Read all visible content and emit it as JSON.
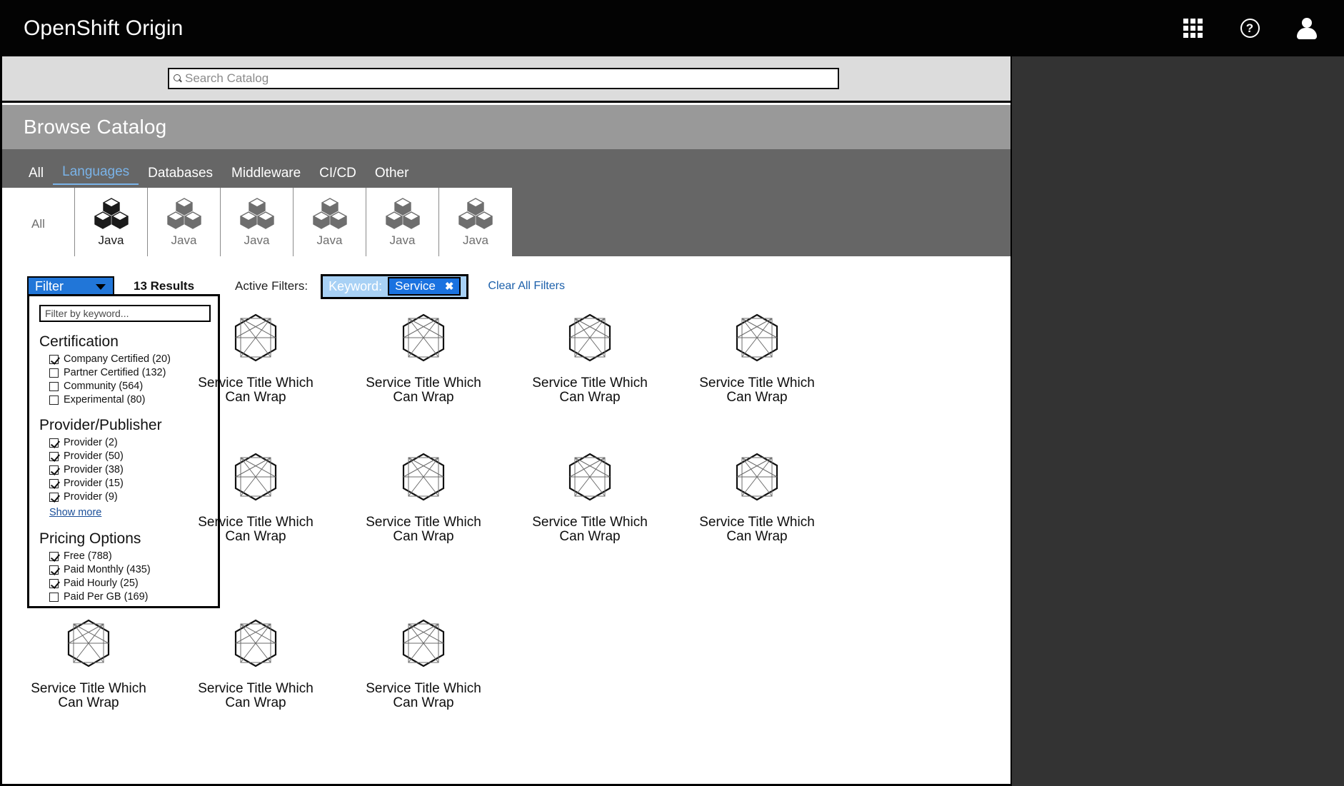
{
  "masthead": {
    "brand": "OpenShift Origin",
    "icons": [
      {
        "name": "apps-grid-icon",
        "label": "Applications"
      },
      {
        "name": "help-icon",
        "label": "?"
      },
      {
        "name": "user-avatar-icon",
        "label": "User"
      }
    ]
  },
  "search": {
    "placeholder": "Search Catalog",
    "value": "",
    "icon": "search-icon"
  },
  "page": {
    "title": "Browse Catalog"
  },
  "tabs": [
    {
      "label": "All",
      "active": false
    },
    {
      "label": "Languages",
      "active": true
    },
    {
      "label": "Databases",
      "active": false
    },
    {
      "label": "Middleware",
      "active": false
    },
    {
      "label": "CI/CD",
      "active": false
    },
    {
      "label": "Other",
      "active": false
    }
  ],
  "tiles": [
    {
      "label": "All",
      "icon": "",
      "active": false
    },
    {
      "label": "Java",
      "icon": "cubes-icon",
      "active": true
    },
    {
      "label": "Java",
      "icon": "cubes-icon",
      "active": false
    },
    {
      "label": "Java",
      "icon": "cubes-icon",
      "active": false
    },
    {
      "label": "Java",
      "icon": "cubes-icon",
      "active": false
    },
    {
      "label": "Java",
      "icon": "cubes-icon",
      "active": false
    },
    {
      "label": "Java",
      "icon": "cubes-icon",
      "active": false
    }
  ],
  "toolbar": {
    "filter_label": "Filter",
    "results_label": "13 Results",
    "active_filters_label": "Active Filters:",
    "keyword_label": "Keyword:",
    "keyword_value": "Service",
    "keyword_remove": "✖",
    "clear_all_label": "Clear All Filters"
  },
  "filter_panel": {
    "keyword_placeholder": "Filter by keyword...",
    "keyword_value": "",
    "groups": [
      {
        "title": "Certification",
        "items": [
          {
            "label": "Company Certified (20)",
            "checked": true
          },
          {
            "label": "Partner Certified (132)",
            "checked": false
          },
          {
            "label": "Community (564)",
            "checked": false
          },
          {
            "label": "Experimental (80)",
            "checked": false
          }
        ]
      },
      {
        "title": "Provider/Publisher",
        "items": [
          {
            "label": "Provider (2)",
            "checked": true
          },
          {
            "label": "Provider (50)",
            "checked": true
          },
          {
            "label": "Provider (38)",
            "checked": true
          },
          {
            "label": "Provider (15)",
            "checked": true
          },
          {
            "label": "Provider (9)",
            "checked": true
          }
        ],
        "show_more": "Show more"
      },
      {
        "title": "Pricing Options",
        "items": [
          {
            "label": "Free (788)",
            "checked": true
          },
          {
            "label": "Paid Monthly (435)",
            "checked": true
          },
          {
            "label": "Paid Hourly (25)",
            "checked": true
          },
          {
            "label": "Paid Per GB (169)",
            "checked": false
          }
        ]
      }
    ]
  },
  "services": [
    {
      "title": "Service Title Which Can Wrap",
      "icon": "hexagon-placeholder-icon"
    },
    {
      "title": "Service Title Which Can Wrap",
      "icon": "hexagon-placeholder-icon"
    },
    {
      "title": "Service Title Which Can Wrap",
      "icon": "hexagon-placeholder-icon"
    },
    {
      "title": "Service Title Which Can Wrap",
      "icon": "hexagon-placeholder-icon"
    },
    {
      "title": "Service Title Which Can Wrap",
      "icon": "hexagon-placeholder-icon"
    },
    {
      "title": "Service Title Which Can Wrap",
      "icon": "hexagon-placeholder-icon"
    },
    {
      "title": "Service Title Which Can Wrap",
      "icon": "hexagon-placeholder-icon"
    },
    {
      "title": "Service Title Which Can Wrap",
      "icon": "hexagon-placeholder-icon"
    },
    {
      "title": "Service Title Which Can Wrap",
      "icon": "hexagon-placeholder-icon"
    },
    {
      "title": "Service Title Which Can Wrap",
      "icon": "hexagon-placeholder-icon"
    },
    {
      "title": "Service Title Which Can Wrap",
      "icon": "hexagon-placeholder-icon"
    }
  ],
  "colors": {
    "masthead_bg": "#030303",
    "accent_blue": "#2176d8",
    "tab_active": "#7ab3e8",
    "title_band": "#999999",
    "tab_band": "#666666",
    "search_band": "#dcdcdc",
    "outer_bg": "#333333",
    "link": "#1b5faa"
  }
}
